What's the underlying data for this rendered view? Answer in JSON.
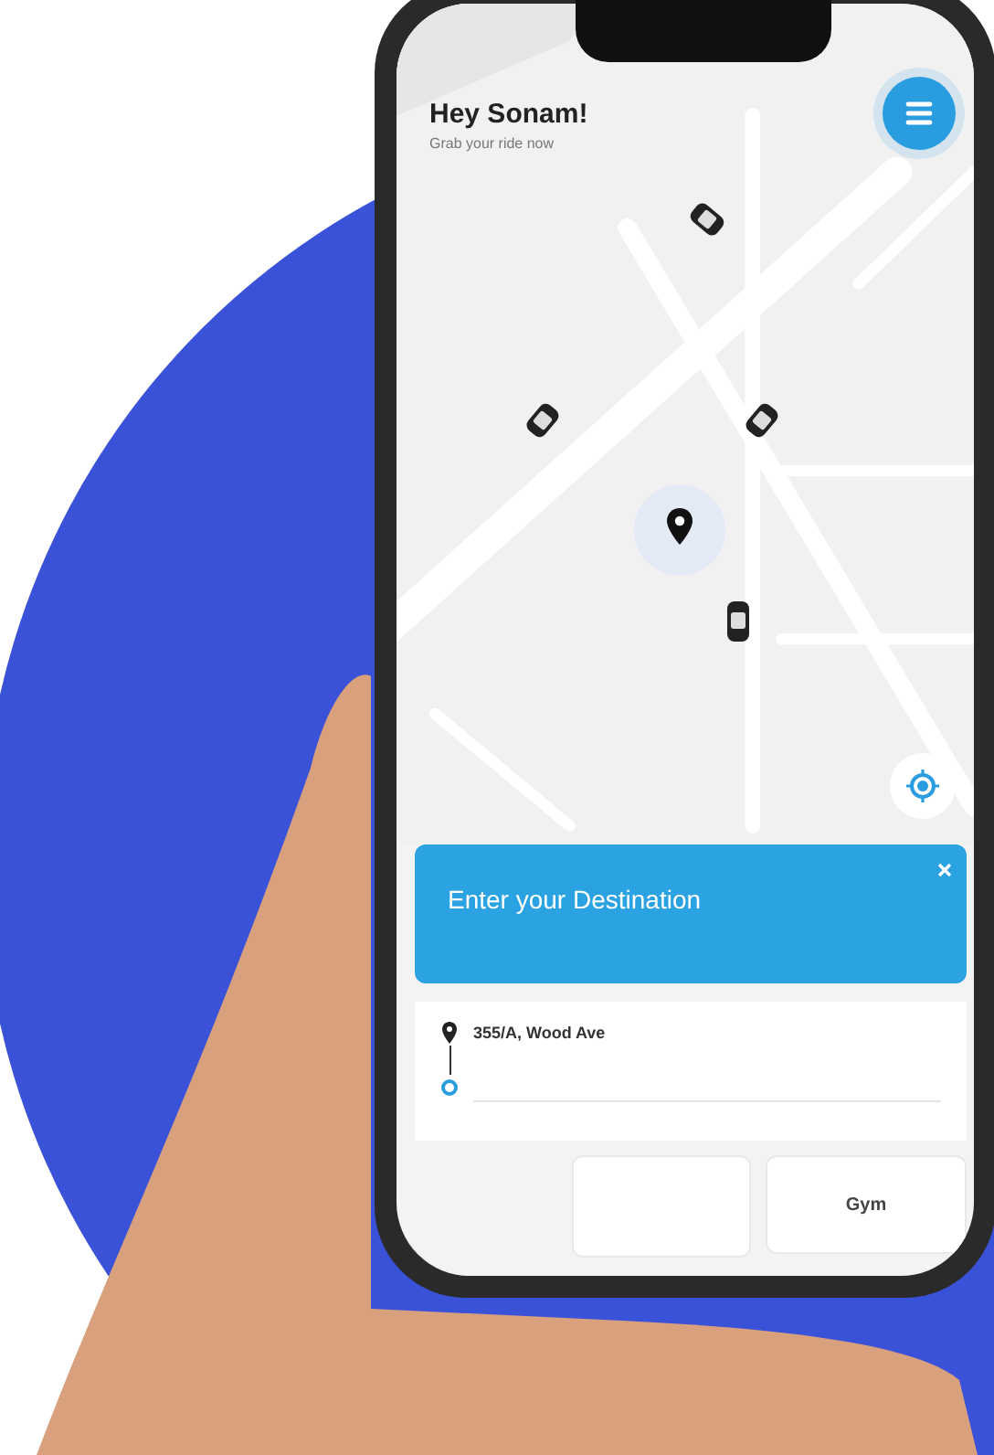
{
  "header": {
    "title": "Hey Sonam!",
    "subtitle": "Grab your ride now"
  },
  "destination_card": {
    "title": "Enter your Destination"
  },
  "route": {
    "pickup": "355/A, Wood Ave"
  },
  "places": [
    {
      "label": "Gym"
    }
  ]
}
